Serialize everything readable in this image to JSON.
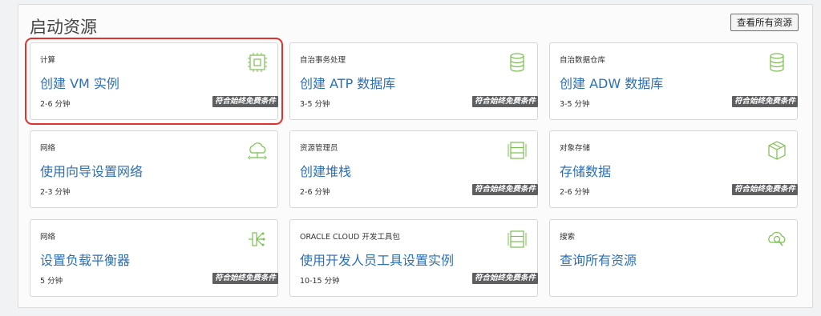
{
  "panel": {
    "title": "启动资源",
    "view_all_label": "查看所有资源"
  },
  "cards": [
    {
      "category": "计算",
      "title": "创建 VM 实例",
      "time": "2-6 分钟",
      "badge": "符合始终免费条件",
      "icon": "chip-icon"
    },
    {
      "category": "自治事务处理",
      "title": "创建 ATP 数据库",
      "time": "3-5 分钟",
      "badge": "符合始终免费条件",
      "icon": "database-icon"
    },
    {
      "category": "自治数据仓库",
      "title": "创建 ADW 数据库",
      "time": "3-5 分钟",
      "badge": "符合始终免费条件",
      "icon": "database-icon"
    },
    {
      "category": "网络",
      "title": "使用向导设置网络",
      "time": "2-3 分钟",
      "badge": "",
      "icon": "cloud-network-icon"
    },
    {
      "category": "资源管理员",
      "title": "创建堆栈",
      "time": "2-6 分钟",
      "badge": "符合始终免费条件",
      "icon": "stack-icon"
    },
    {
      "category": "对象存储",
      "title": "存储数据",
      "time": "2-6 分钟",
      "badge": "符合始终免费条件",
      "icon": "storage-box-icon"
    },
    {
      "category": "网络",
      "title": "设置负载平衡器",
      "time": "5 分钟",
      "badge": "符合始终免费条件",
      "icon": "load-balancer-icon"
    },
    {
      "category": "ORACLE CLOUD 开发工具包",
      "title": "使用开发人员工具设置实例",
      "time": "10-15 分钟",
      "badge": "符合始终免费条件",
      "icon": "stack-icon"
    },
    {
      "category": "搜索",
      "title": "查询所有资源",
      "time": "",
      "badge": "",
      "icon": "cloud-search-icon"
    }
  ]
}
